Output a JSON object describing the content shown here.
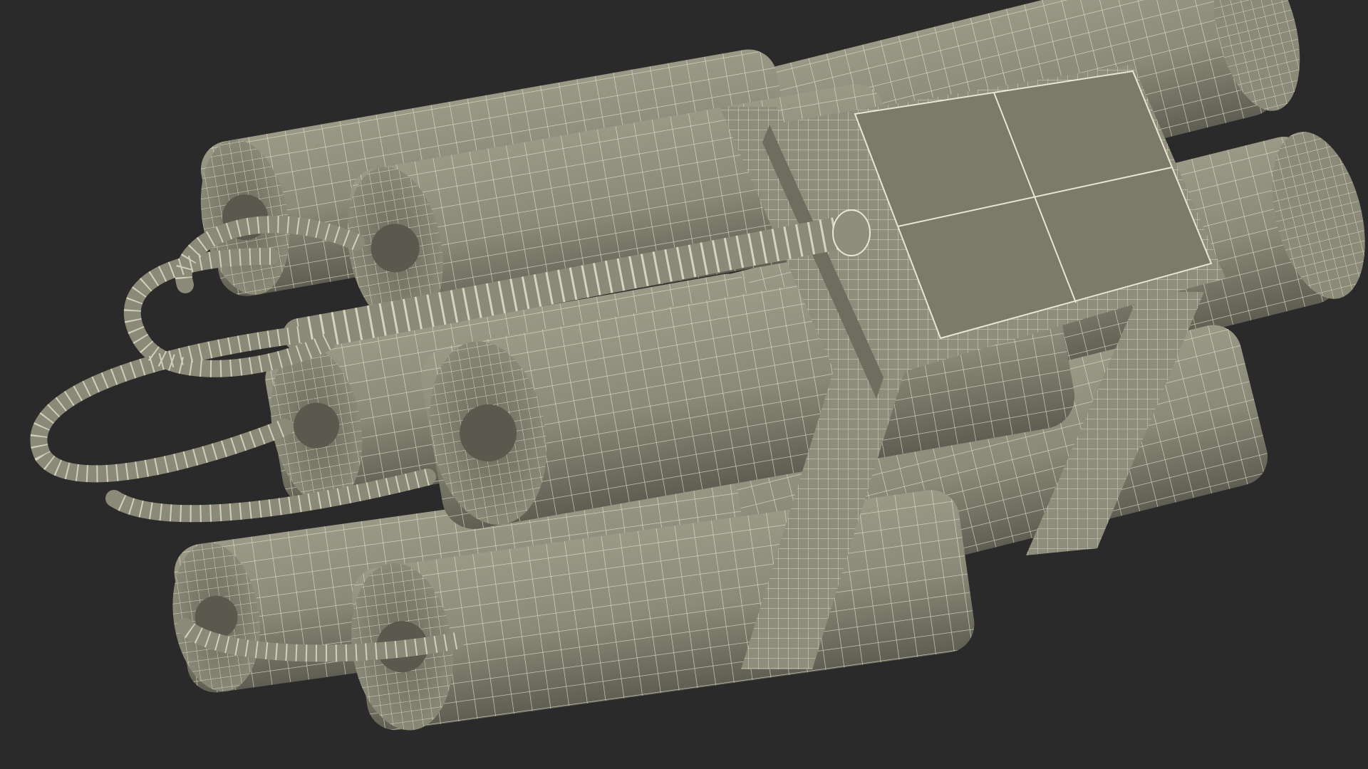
{
  "scene": {
    "subject": "wireframe-dynamite-bundle-with-timer",
    "background_color": "#2a2a2a",
    "surface_color": "#8b8a79",
    "surface_shade_color": "#6e6d5f",
    "wire_color": "#e8e6d2",
    "timer_screen_color": "#7b7a6b",
    "stick_count": 6,
    "strap_count": 2
  }
}
